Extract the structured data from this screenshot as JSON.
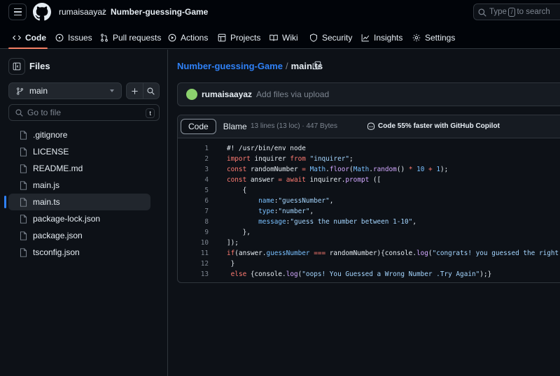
{
  "header": {
    "owner": "rumaisaayaz",
    "separator": "/",
    "repo": "Number-guessing-Game",
    "search_prefix": "Type",
    "search_key": "/",
    "search_suffix": "to search"
  },
  "nav": {
    "items": [
      {
        "label": "Code",
        "icon": "code-icon"
      },
      {
        "label": "Issues",
        "icon": "issue-icon"
      },
      {
        "label": "Pull requests",
        "icon": "pull-request-icon"
      },
      {
        "label": "Actions",
        "icon": "play-icon"
      },
      {
        "label": "Projects",
        "icon": "table-icon"
      },
      {
        "label": "Wiki",
        "icon": "book-icon"
      },
      {
        "label": "Security",
        "icon": "shield-icon"
      },
      {
        "label": "Insights",
        "icon": "graph-icon"
      },
      {
        "label": "Settings",
        "icon": "gear-icon"
      }
    ]
  },
  "sidebar": {
    "title": "Files",
    "branch": "main",
    "goto_placeholder": "Go to file",
    "goto_key": "t",
    "files": [
      {
        "name": ".gitignore",
        "active": false
      },
      {
        "name": "LICENSE",
        "active": false
      },
      {
        "name": "README.md",
        "active": false
      },
      {
        "name": "main.js",
        "active": false
      },
      {
        "name": "main.ts",
        "active": true
      },
      {
        "name": "package-lock.json",
        "active": false
      },
      {
        "name": "package.json",
        "active": false
      },
      {
        "name": "tsconfig.json",
        "active": false
      }
    ]
  },
  "main": {
    "path_repo": "Number-guessing-Game",
    "path_sep": "/",
    "path_file": "main.ts",
    "commit_user": "rumaisaayaz",
    "commit_msg": "Add files via upload",
    "tab_code": "Code",
    "tab_blame": "Blame",
    "meta": "13 lines (13 loc) · 447 Bytes",
    "copilot": "Code 55% faster with GitHub Copilot"
  },
  "code": {
    "lines": [
      {
        "n": "1",
        "t": [
          [
            "t",
            "#! /usr/bin/env node"
          ]
        ]
      },
      {
        "n": "2",
        "t": [
          [
            "k",
            "import"
          ],
          [
            "t",
            " inquirer "
          ],
          [
            "k",
            "from"
          ],
          [
            "t",
            " "
          ],
          [
            "s",
            "\"inquirer\""
          ],
          [
            "t",
            ";"
          ]
        ]
      },
      {
        "n": "3",
        "t": [
          [
            "k",
            "const"
          ],
          [
            "t",
            " randomNumber "
          ],
          [
            "k",
            "="
          ],
          [
            "t",
            " "
          ],
          [
            "p",
            "Math"
          ],
          [
            "t",
            "."
          ],
          [
            "f",
            "floor"
          ],
          [
            "t",
            "("
          ],
          [
            "p",
            "Math"
          ],
          [
            "t",
            "."
          ],
          [
            "f",
            "random"
          ],
          [
            "t",
            "() "
          ],
          [
            "k",
            "*"
          ],
          [
            "t",
            " "
          ],
          [
            "p",
            "10"
          ],
          [
            "t",
            " "
          ],
          [
            "k",
            "+"
          ],
          [
            "t",
            " "
          ],
          [
            "p",
            "1"
          ],
          [
            "t",
            ");"
          ]
        ]
      },
      {
        "n": "4",
        "t": [
          [
            "k",
            "const"
          ],
          [
            "t",
            " answer "
          ],
          [
            "k",
            "="
          ],
          [
            "t",
            " "
          ],
          [
            "k",
            "await"
          ],
          [
            "t",
            " inquirer."
          ],
          [
            "f",
            "prompt"
          ],
          [
            "t",
            " (["
          ]
        ]
      },
      {
        "n": "5",
        "t": [
          [
            "t",
            "    {"
          ]
        ]
      },
      {
        "n": "6",
        "t": [
          [
            "t",
            "        "
          ],
          [
            "p",
            "name"
          ],
          [
            "t",
            ":"
          ],
          [
            "s",
            "\"guessNumber\""
          ],
          [
            "t",
            ","
          ]
        ]
      },
      {
        "n": "7",
        "t": [
          [
            "t",
            "        "
          ],
          [
            "p",
            "type"
          ],
          [
            "t",
            ":"
          ],
          [
            "s",
            "\"number\""
          ],
          [
            "t",
            ","
          ]
        ]
      },
      {
        "n": "8",
        "t": [
          [
            "t",
            "        "
          ],
          [
            "p",
            "message"
          ],
          [
            "t",
            ":"
          ],
          [
            "s",
            "\"guess the number between 1-10\""
          ],
          [
            "t",
            ","
          ]
        ]
      },
      {
        "n": "9",
        "t": [
          [
            "t",
            "    },"
          ]
        ]
      },
      {
        "n": "10",
        "t": [
          [
            "t",
            "]);"
          ]
        ]
      },
      {
        "n": "11",
        "t": [
          [
            "k",
            "if"
          ],
          [
            "t",
            "(answer."
          ],
          [
            "p",
            "guessNumber"
          ],
          [
            "t",
            " "
          ],
          [
            "k",
            "==="
          ],
          [
            "t",
            " randomNumber){console."
          ],
          [
            "f",
            "log"
          ],
          [
            "t",
            "("
          ],
          [
            "s",
            "\"congrats! you guessed the right number:)\""
          ],
          [
            "t",
            ");"
          ]
        ]
      },
      {
        "n": "12",
        "t": [
          [
            "t",
            " }"
          ]
        ]
      },
      {
        "n": "13",
        "t": [
          [
            "t",
            " "
          ],
          [
            "k",
            "else"
          ],
          [
            "t",
            " {console."
          ],
          [
            "f",
            "log"
          ],
          [
            "t",
            "("
          ],
          [
            "s",
            "\"oops! You Guessed a Wrong Number .Try Again\""
          ],
          [
            "t",
            ");}"
          ]
        ]
      }
    ]
  }
}
